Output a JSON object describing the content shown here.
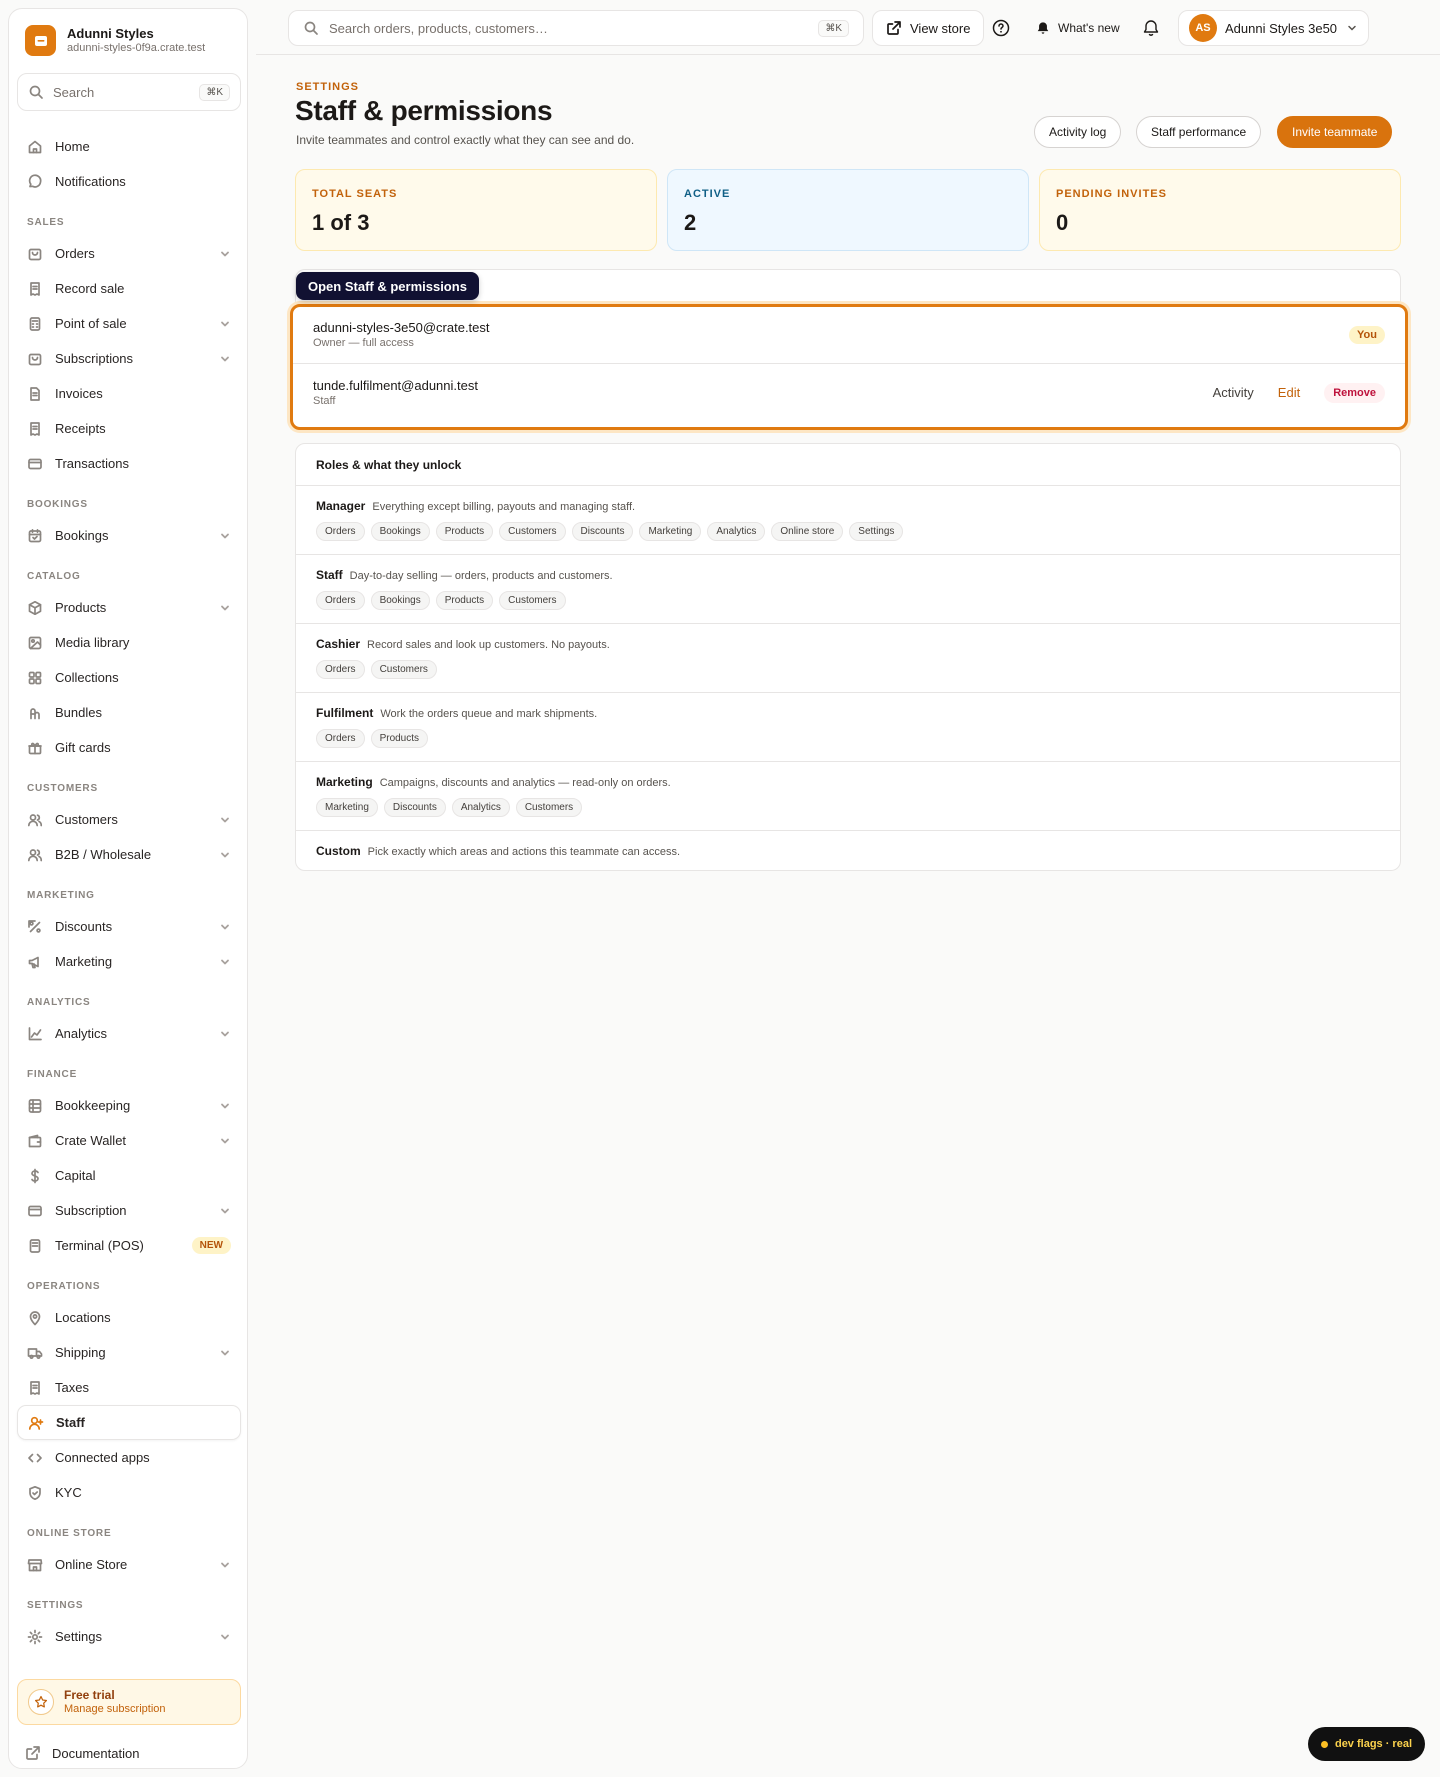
{
  "brand": {
    "name": "Adunni Styles",
    "domain": "adunni-styles-0f9a.crate.test"
  },
  "sidebar_search": {
    "placeholder": "Search",
    "shortcut": "⌘K"
  },
  "nav": [
    {
      "type": "item",
      "label": "Home",
      "icon": "home-icon"
    },
    {
      "type": "item",
      "label": "Notifications",
      "icon": "chat-bubble-icon"
    },
    {
      "type": "section",
      "label": "SALES"
    },
    {
      "type": "item",
      "label": "Orders",
      "icon": "bag-icon",
      "chevron": true
    },
    {
      "type": "item",
      "label": "Record sale",
      "icon": "receipt-icon"
    },
    {
      "type": "item",
      "label": "Point of sale",
      "icon": "calculator-icon",
      "chevron": true
    },
    {
      "type": "item",
      "label": "Subscriptions",
      "icon": "bag-icon",
      "chevron": true
    },
    {
      "type": "item",
      "label": "Invoices",
      "icon": "document-icon"
    },
    {
      "type": "item",
      "label": "Receipts",
      "icon": "receipt-icon"
    },
    {
      "type": "item",
      "label": "Transactions",
      "icon": "card-icon"
    },
    {
      "type": "section",
      "label": "BOOKINGS"
    },
    {
      "type": "item",
      "label": "Bookings",
      "icon": "calendar-icon",
      "chevron": true
    },
    {
      "type": "section",
      "label": "CATALOG"
    },
    {
      "type": "item",
      "label": "Products",
      "icon": "box-icon",
      "chevron": true
    },
    {
      "type": "item",
      "label": "Media library",
      "icon": "image-icon"
    },
    {
      "type": "item",
      "label": "Collections",
      "icon": "grid-icon"
    },
    {
      "type": "item",
      "label": "Bundles",
      "icon": "bundle-icon"
    },
    {
      "type": "item",
      "label": "Gift cards",
      "icon": "gift-icon"
    },
    {
      "type": "section",
      "label": "CUSTOMERS"
    },
    {
      "type": "item",
      "label": "Customers",
      "icon": "users-icon",
      "chevron": true
    },
    {
      "type": "item",
      "label": "B2B / Wholesale",
      "icon": "users-icon",
      "chevron": true
    },
    {
      "type": "section",
      "label": "MARKETING"
    },
    {
      "type": "item",
      "label": "Discounts",
      "icon": "percent-icon",
      "chevron": true
    },
    {
      "type": "item",
      "label": "Marketing",
      "icon": "megaphone-icon",
      "chevron": true
    },
    {
      "type": "section",
      "label": "ANALYTICS"
    },
    {
      "type": "item",
      "label": "Analytics",
      "icon": "chart-line-icon",
      "chevron": true
    },
    {
      "type": "section",
      "label": "FINANCE"
    },
    {
      "type": "item",
      "label": "Bookkeeping",
      "icon": "ledger-icon",
      "chevron": true
    },
    {
      "type": "item",
      "label": "Crate Wallet",
      "icon": "wallet-icon",
      "chevron": true
    },
    {
      "type": "item",
      "label": "Capital",
      "icon": "dollar-icon"
    },
    {
      "type": "item",
      "label": "Subscription",
      "icon": "card-icon",
      "chevron": true
    },
    {
      "type": "item",
      "label": "Terminal (POS)",
      "icon": "terminal-icon",
      "badge": "NEW"
    },
    {
      "type": "section",
      "label": "OPERATIONS"
    },
    {
      "type": "item",
      "label": "Locations",
      "icon": "pin-icon"
    },
    {
      "type": "item",
      "label": "Shipping",
      "icon": "truck-icon",
      "chevron": true
    },
    {
      "type": "item",
      "label": "Taxes",
      "icon": "receipt-icon"
    },
    {
      "type": "item",
      "label": "Staff",
      "icon": "user-plus-icon",
      "active": true
    },
    {
      "type": "item",
      "label": "Connected apps",
      "icon": "code-icon"
    },
    {
      "type": "item",
      "label": "KYC",
      "icon": "shield-icon"
    },
    {
      "type": "section",
      "label": "ONLINE STORE"
    },
    {
      "type": "item",
      "label": "Online Store",
      "icon": "store-icon",
      "chevron": true
    },
    {
      "type": "section",
      "label": "SETTINGS"
    },
    {
      "type": "item",
      "label": "Settings",
      "icon": "gear-icon",
      "chevron": true
    }
  ],
  "trial": {
    "title": "Free trial",
    "link": "Manage subscription"
  },
  "docs_label": "Documentation",
  "topbar": {
    "search_placeholder": "Search orders, products, customers…",
    "search_shortcut": "⌘K",
    "view_store": "View store",
    "whats_new": "What's new",
    "account_initials": "AS",
    "account_name": "Adunni Styles 3e50"
  },
  "header": {
    "eyebrow": "SETTINGS",
    "title": "Staff & permissions",
    "subtitle": "Invite teammates and control exactly what they can see and do.",
    "activity_log": "Activity log",
    "staff_performance": "Staff performance",
    "invite": "Invite teammate"
  },
  "stats": [
    {
      "label": "TOTAL SEATS",
      "value": "1 of 3",
      "color": "#c2620b",
      "bg": "#fffaeb",
      "border": "#fde9b0"
    },
    {
      "label": "ACTIVE",
      "value": "2",
      "color": "#0f5f86",
      "bg": "#eff8ff",
      "border": "#cfe6f7"
    },
    {
      "label": "PENDING INVITES",
      "value": "0",
      "color": "#c2620b",
      "bg": "#fffaeb",
      "border": "#fde9b0"
    }
  ],
  "tooltip": "Open Staff & permissions",
  "members": [
    {
      "email": "adunni-styles-3e50@crate.test",
      "role": "Owner — full access",
      "badge": "You"
    },
    {
      "email": "tunde.fulfilment@adunni.test",
      "role": "Staff",
      "actions": {
        "activity": "Activity",
        "edit": "Edit",
        "remove": "Remove"
      }
    }
  ],
  "roles_title": "Roles & what they unlock",
  "roles": [
    {
      "name": "Manager",
      "desc": "Everything except billing, payouts and managing staff.",
      "chips": [
        "Orders",
        "Bookings",
        "Products",
        "Customers",
        "Discounts",
        "Marketing",
        "Analytics",
        "Online store",
        "Settings"
      ]
    },
    {
      "name": "Staff",
      "desc": "Day-to-day selling — orders, products and customers.",
      "chips": [
        "Orders",
        "Bookings",
        "Products",
        "Customers"
      ]
    },
    {
      "name": "Cashier",
      "desc": "Record sales and look up customers. No payouts.",
      "chips": [
        "Orders",
        "Customers"
      ]
    },
    {
      "name": "Fulfilment",
      "desc": "Work the orders queue and mark shipments.",
      "chips": [
        "Orders",
        "Products"
      ]
    },
    {
      "name": "Marketing",
      "desc": "Campaigns, discounts and analytics — read-only on orders.",
      "chips": [
        "Marketing",
        "Discounts",
        "Analytics",
        "Customers"
      ]
    },
    {
      "name": "Custom",
      "desc": "Pick exactly which areas and actions this teammate can access.",
      "chips": []
    }
  ],
  "dev_flags": "dev flags · real",
  "colors": {
    "accent": "#e07a10",
    "danger": "#be123c"
  }
}
